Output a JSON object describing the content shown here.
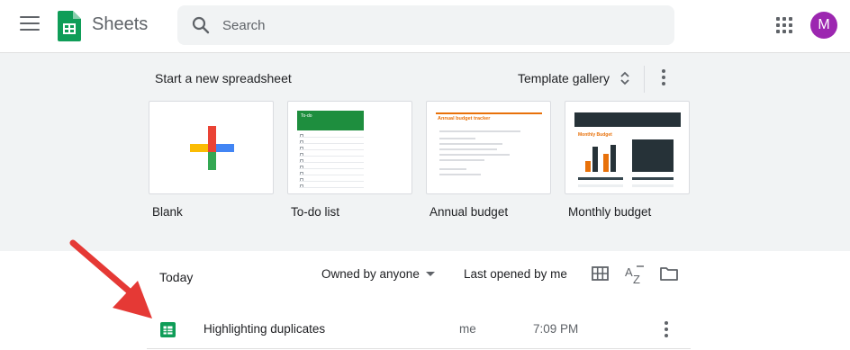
{
  "header": {
    "app_name": "Sheets",
    "search_placeholder": "Search",
    "avatar_letter": "M",
    "icons": [
      "main-menu-icon",
      "sheets-logo",
      "search-icon",
      "apps-grid-icon"
    ]
  },
  "templates": {
    "heading": "Start a new spreadsheet",
    "gallery_label": "Template gallery",
    "items": [
      {
        "label": "Blank",
        "thumb": "blank"
      },
      {
        "label": "To-do list",
        "thumb": "todo",
        "thumb_title": "To-do"
      },
      {
        "label": "Annual budget",
        "thumb": "annual",
        "thumb_title": "Annual budget tracker"
      },
      {
        "label": "Monthly budget",
        "thumb": "monthly",
        "thumb_title": "Monthly Budget"
      }
    ]
  },
  "files": {
    "section_label": "Today",
    "owner_filter": "Owned by anyone",
    "sort_label": "Last opened by me",
    "rows": [
      {
        "name": "Highlighting duplicates",
        "owner": "me",
        "time": "7:09 PM"
      }
    ]
  },
  "colors": {
    "sheets_green": "#0f9d58",
    "avatar": "#9c27b0",
    "band_background": "#f1f3f4",
    "annotation_arrow": "#e53935"
  }
}
